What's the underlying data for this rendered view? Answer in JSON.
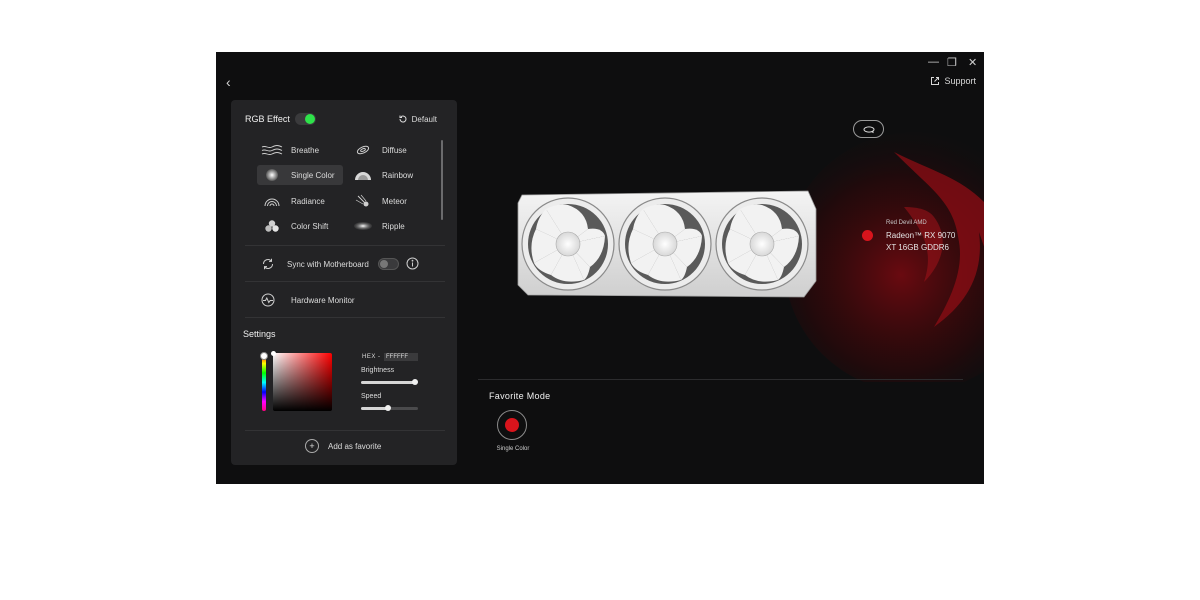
{
  "window": {
    "minimize_glyph": "—",
    "restore_glyph": "❐",
    "close_glyph": "✕",
    "back_glyph": "‹",
    "support_label": "Support"
  },
  "rgb": {
    "title": "RGB Effect",
    "enabled": true,
    "default_label": "Default",
    "effects": [
      {
        "label": "Breathe",
        "icon": "breathe-icon"
      },
      {
        "label": "Diffuse",
        "icon": "diffuse-icon"
      },
      {
        "label": "Single Color",
        "icon": "single-color-icon",
        "selected": true
      },
      {
        "label": "Rainbow",
        "icon": "rainbow-icon"
      },
      {
        "label": "Radiance",
        "icon": "radiance-icon"
      },
      {
        "label": "Meteor",
        "icon": "meteor-icon"
      },
      {
        "label": "Color Shift",
        "icon": "color-shift-icon"
      },
      {
        "label": "Ripple",
        "icon": "ripple-icon"
      }
    ],
    "sync_label": "Sync with Motherboard",
    "sync_enabled": false,
    "hardware_monitor_label": "Hardware Monitor"
  },
  "settings": {
    "title": "Settings",
    "hex_label": "HEX -",
    "hex_value": "FFFFFF",
    "brightness_label": "Brightness",
    "brightness_value": 0.95,
    "speed_label": "Speed",
    "speed_value": 0.48,
    "add_favorite_label": "Add as favorite"
  },
  "device": {
    "brand": "Red Devil AMD",
    "model": "Radeon™ RX 9070 XT 16GB GDDR6",
    "status_color": "#d8141c"
  },
  "favorite": {
    "title": "Favorite Mode",
    "items": [
      {
        "label": "Single Color",
        "color": "#d8141c"
      }
    ]
  },
  "colors": {
    "accent_green": "#2ee24a",
    "accent_red": "#d8141c",
    "panel_bg": "#232325",
    "app_bg": "#0e0e0f"
  }
}
